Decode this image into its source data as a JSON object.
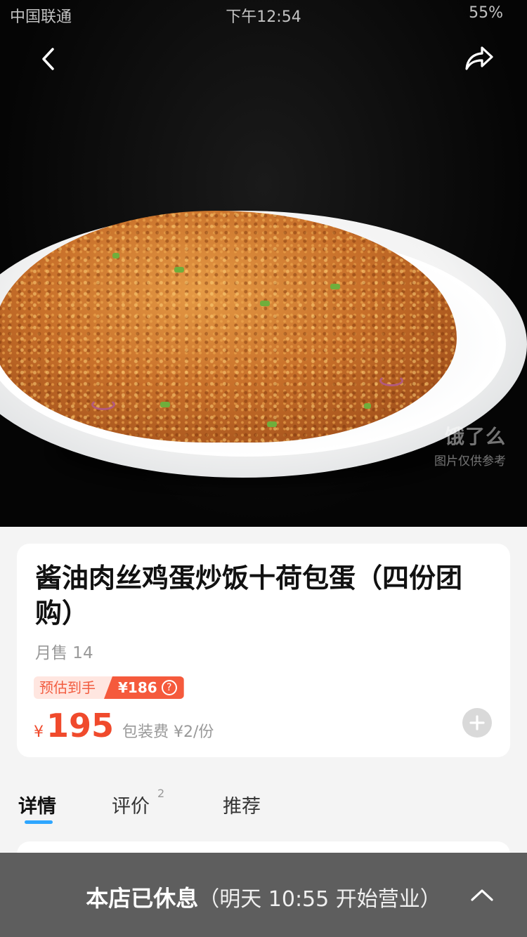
{
  "status_bar": {
    "carrier": "中国联通",
    "time": "下午12:54",
    "battery": "55%"
  },
  "hero": {
    "watermark_logo": "饿了么",
    "watermark_note": "图片仅供参考"
  },
  "product": {
    "title": "酱油肉丝鸡蛋炒饭十荷包蛋（四份团购）",
    "monthly_sales": "月售 14",
    "estimate_label": "预估到手",
    "estimate_value": "¥186",
    "currency_symbol": "¥",
    "price": "195",
    "packing_fee": "包装费 ¥2/份"
  },
  "tabs": [
    {
      "label": "详情",
      "active": true
    },
    {
      "label": "评价",
      "count": "2",
      "active": false
    },
    {
      "label": "推荐",
      "active": false
    }
  ],
  "closed_bar": {
    "status": "本店已休息",
    "reopen_note": "（明天 10:55 开始营业）"
  },
  "colors": {
    "accent_red": "#f04a2c",
    "tab_indicator": "#2ea6ff",
    "closed_bar_bg": "#555555"
  },
  "icons": {
    "back": "chevron-left-icon",
    "share": "share-arrow-icon",
    "help": "question-circle-icon",
    "add": "plus-circle-icon",
    "expand": "chevron-up-icon"
  }
}
